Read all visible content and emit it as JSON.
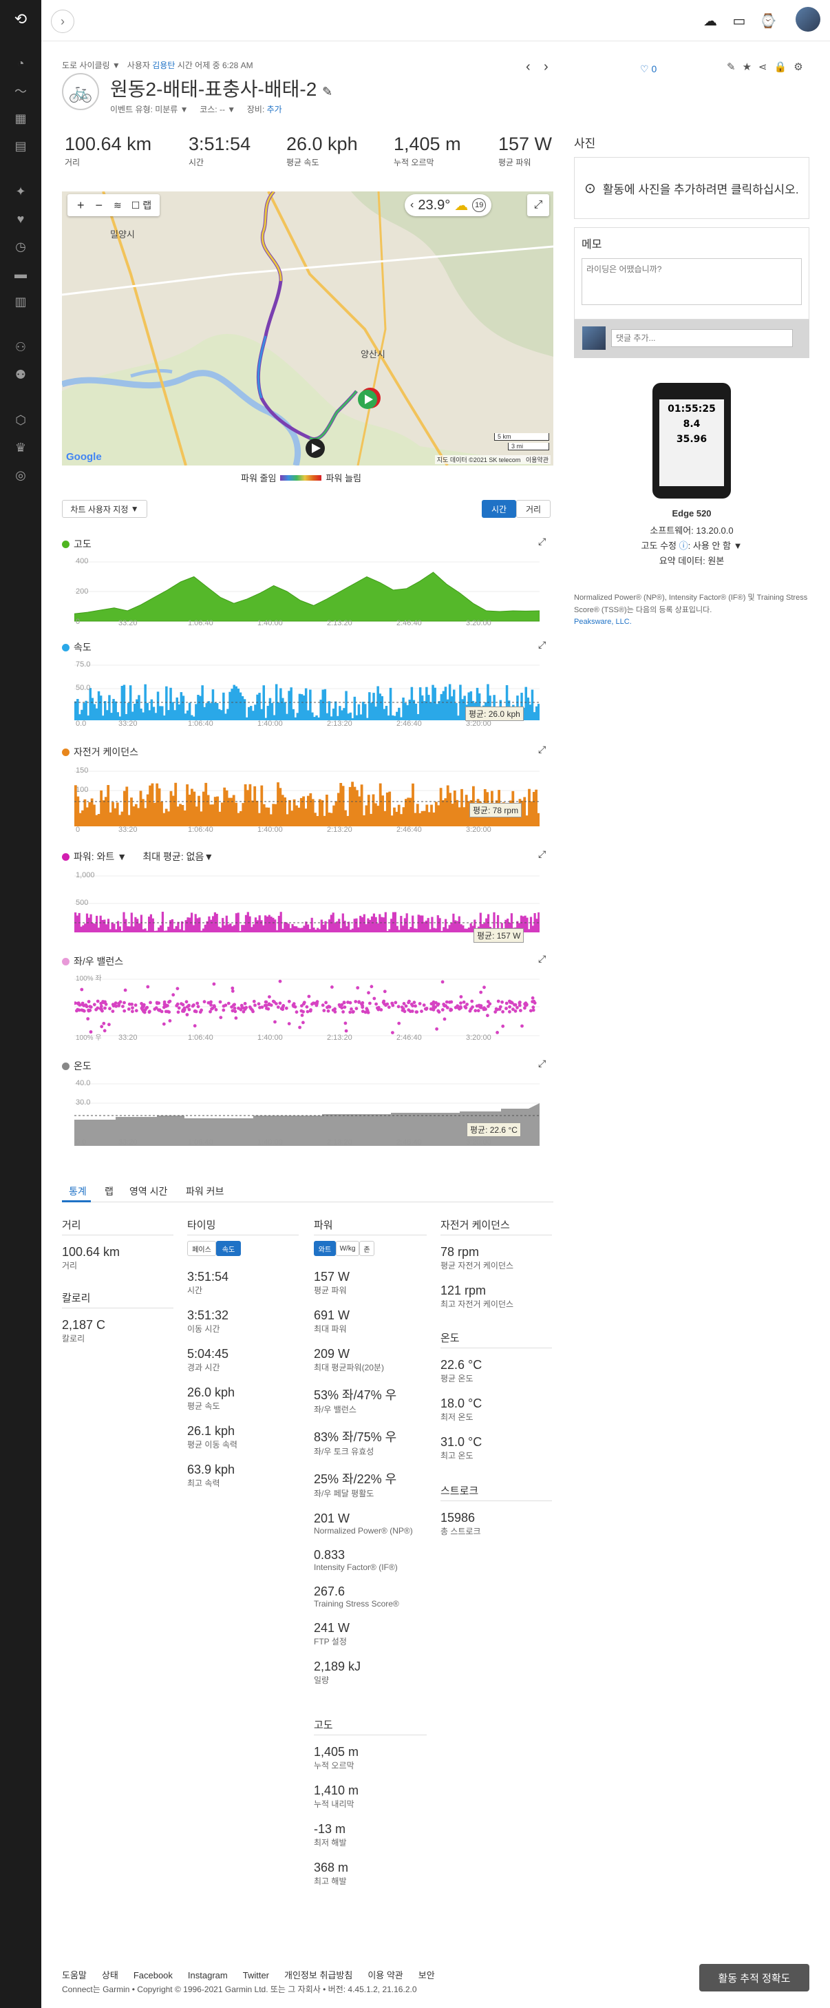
{
  "app": {
    "logo": "garmin-connect-logo"
  },
  "header": {
    "breadcrumb_type": "도로 사이클링",
    "user_prefix": "사용자",
    "user_name": "김용탄",
    "time_prefix": "시간",
    "time_value": "어제 중 6:28 AM",
    "title": "원동2-배태-표충사-배태-2",
    "event_type_label": "이벤트 유형: 미분류",
    "course_label": "코스: --",
    "gear_label": "장비:",
    "gear_add": "추가",
    "likes": "0"
  },
  "summary": [
    {
      "value": "100.64 km",
      "label": "거리"
    },
    {
      "value": "3:51:54",
      "label": "시간"
    },
    {
      "value": "26.0 kph",
      "label": "평균 속도"
    },
    {
      "value": "1,405 m",
      "label": "누적 오르막"
    },
    {
      "value": "157 W",
      "label": "평균 파워"
    }
  ],
  "map": {
    "lap_label": "랩",
    "temperature": "23.9°",
    "weather_badge": "19",
    "place_1": "밀양시",
    "place_2": "양산시",
    "scale_km": "5 km",
    "scale_mi": "3 mi",
    "attribution": "지도 데이터 ©2021 SK telecom",
    "terms": "이용약관",
    "google": "Google",
    "legend_low": "파워 줄임",
    "legend_high": "파워 늘림"
  },
  "charts": {
    "customize_label": "차트 사용자 지정",
    "toggle_time": "시간",
    "toggle_distance": "거리",
    "time_ticks": [
      "33:20",
      "1:06:40",
      "1:40:00",
      "2:13:20",
      "2:46:40",
      "3:20:00"
    ],
    "elevation_title": "고도",
    "speed_title": "속도",
    "speed_avg": "평균: 26.0 kph",
    "cadence_title": "자전거 케이던스",
    "cadence_avg": "평균: 78 rpm",
    "power_title": "파워: 와트",
    "power_max_label": "최대 평균: 없음",
    "power_avg": "평균: 157 W",
    "balance_title": "좌/우 밸런스",
    "temp_title": "온도",
    "temp_avg": "평균: 22.6 °C"
  },
  "chart_data": [
    {
      "type": "area",
      "title": "고도",
      "ylim": [
        0,
        400
      ],
      "yticks": [
        "400",
        "200",
        "0"
      ],
      "values": [
        50,
        60,
        75,
        90,
        70,
        110,
        160,
        210,
        265,
        300,
        230,
        160,
        120,
        150,
        190,
        240,
        200,
        140,
        105,
        150,
        200,
        250,
        300,
        260,
        210,
        220,
        270,
        330,
        250,
        190,
        120,
        70,
        65,
        70,
        68,
        70
      ]
    },
    {
      "type": "area",
      "title": "속도",
      "ylim": [
        0,
        75
      ],
      "yticks": [
        "75.0",
        "50.0",
        "0.0"
      ],
      "avg": 26.0
    },
    {
      "type": "bar",
      "title": "자전거 케이던스",
      "ylim": [
        0,
        150
      ],
      "yticks": [
        "150",
        "100",
        "0"
      ],
      "avg": 78
    },
    {
      "type": "area",
      "title": "파워: 와트",
      "ylim": [
        0,
        1000
      ],
      "yticks": [
        "1,000",
        "500"
      ],
      "avg": 157
    },
    {
      "type": "scatter",
      "title": "좌/우 밸런스",
      "yticks": [
        "100% 좌",
        "100% 우"
      ]
    },
    {
      "type": "area",
      "title": "온도",
      "ylim": [
        0,
        40
      ],
      "yticks": [
        "40.0",
        "30.0",
        "0.0"
      ],
      "avg": 22.6
    }
  ],
  "tabs": [
    "통계",
    "랩",
    "영역 시간",
    "파워 커브"
  ],
  "stats": {
    "distance": {
      "head": "거리",
      "value": "100.64 km",
      "label": "거리"
    },
    "calories": {
      "head": "칼로리",
      "value": "2,187 C",
      "label": "칼로리"
    },
    "timing": {
      "head": "타이밍",
      "toggle_pace": "페이스",
      "toggle_speed": "속도",
      "rows": [
        {
          "value": "3:51:54",
          "label": "시간"
        },
        {
          "value": "3:51:32",
          "label": "이동 시간"
        },
        {
          "value": "5:04:45",
          "label": "경과 시간"
        },
        {
          "value": "26.0 kph",
          "label": "평균 속도"
        },
        {
          "value": "26.1 kph",
          "label": "평균 이동 속력"
        },
        {
          "value": "63.9 kph",
          "label": "최고 속력"
        }
      ]
    },
    "power": {
      "head": "파워",
      "toggle_watts": "와트",
      "toggle_wkg": "W/kg",
      "toggle_zone": "존",
      "rows": [
        {
          "value": "157 W",
          "label": "평균 파워"
        },
        {
          "value": "691 W",
          "label": "최대 파워"
        },
        {
          "value": "209 W",
          "label": "최대 평균파워(20분)"
        },
        {
          "value": "53% 좌/47% 우",
          "label": "좌/우 밸런스"
        },
        {
          "value": "83% 좌/75% 우",
          "label": "좌/우 토크 유효성"
        },
        {
          "value": "25% 좌/22% 우",
          "label": "좌/우 페달 평활도"
        },
        {
          "value": "201 W",
          "label": "Normalized Power® (NP®)"
        },
        {
          "value": "0.833",
          "label": "Intensity Factor® (IF®)"
        },
        {
          "value": "267.6",
          "label": "Training Stress Score®"
        },
        {
          "value": "241 W",
          "label": "FTP 설정"
        },
        {
          "value": "2,189 kJ",
          "label": "일량"
        }
      ]
    },
    "elevation": {
      "head": "고도",
      "rows": [
        {
          "value": "1,405 m",
          "label": "누적 오르막"
        },
        {
          "value": "1,410 m",
          "label": "누적 내리막"
        },
        {
          "value": "-13 m",
          "label": "최저 해발"
        },
        {
          "value": "368 m",
          "label": "최고 해발"
        }
      ]
    },
    "cadence": {
      "head": "자전거 케이던스",
      "rows": [
        {
          "value": "78 rpm",
          "label": "평균 자전거 케이던스"
        },
        {
          "value": "121 rpm",
          "label": "최고 자전거 케이던스"
        }
      ]
    },
    "temperature": {
      "head": "온도",
      "rows": [
        {
          "value": "22.6 °C",
          "label": "평균 온도"
        },
        {
          "value": "18.0 °C",
          "label": "최저 온도"
        },
        {
          "value": "31.0 °C",
          "label": "최고 온도"
        }
      ]
    },
    "strokes": {
      "head": "스트로크",
      "value": "15986",
      "label": "총 스트로크"
    }
  },
  "right": {
    "photos_title": "사진",
    "photos_prompt": "활동에 사진을 추가하려면 클릭하십시오.",
    "memo_title": "메모",
    "memo_placeholder": "라이딩은 어땠습니까?",
    "comment_placeholder": "댓글 추가...",
    "device_name": "Edge 520",
    "device_screen_time": "01:55:25",
    "device_screen_speed": "8.4",
    "device_screen_dist": "35.96",
    "software_label": "소프트웨어: 13.20.0.0",
    "elevation_correction_label": "고도 수정",
    "elevation_correction_value": ": 사용 안 함",
    "summary_data_label": "요약 데이터: 원본",
    "trademark_text": "Normalized Power® (NP®), Intensity Factor® (IF®) 및 Training Stress Score® (TSS®)는 다음의 등록 상표입니다.",
    "trademark_owner": "Peaksware, LLC."
  },
  "footer": {
    "links": [
      "도움말",
      "상태",
      "Facebook",
      "Instagram",
      "Twitter",
      "개인정보 취급방침",
      "이용 약관",
      "보안"
    ],
    "copyright": "Connect는 Garmin • Copyright © 1996-2021 Garmin Ltd. 또는 그 자회사 • 버전: 4.45.1.2, 21.16.2.0",
    "feedback_button": "활동 추적 정확도"
  }
}
